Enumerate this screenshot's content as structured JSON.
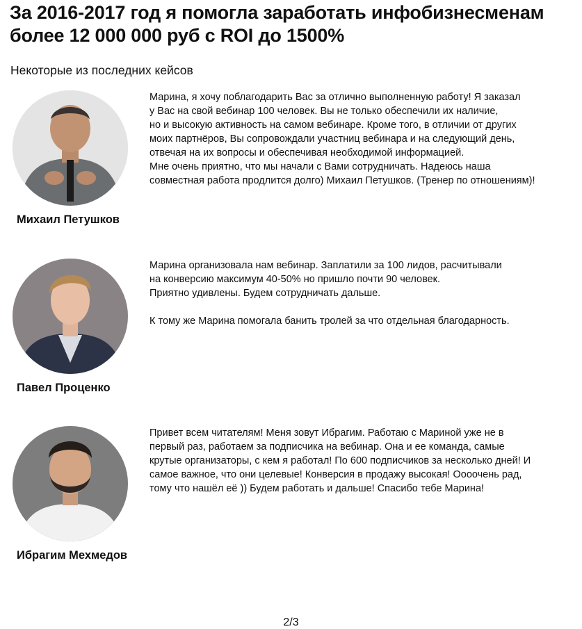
{
  "header": {
    "title_line1": "За 2016-2017 год я помогла заработать инфобизнесменам",
    "title_line2": "более 12 000 000 руб с ROI до 1500%",
    "subtitle": "Некоторые из последних кейсов"
  },
  "cases": [
    {
      "name": "Михаил Петушков",
      "lines": [
        "Марина, я хочу поблагодарить Вас за отлично выполненную работу! Я заказал",
        "у Вас на свой вебинар 100 человек. Вы не только обеспечили их наличие,",
        "но и высокую активность на самом вебинаре. Кроме того, в отличии от других",
        "моих партнёров, Вы сопровождали участниц вебинара и на следующий день,",
        "отвечая на их вопросы и обеспечивая необходимой информацией.",
        "Мне очень приятно, что мы начали с Вами сотрудничать. Надеюсь наша",
        "совместная работа продлится долго) Михаил Петушков. (Тренер по отношениям)!"
      ]
    },
    {
      "name": "Павел Проценко",
      "lines": [
        "Марина организовала нам вебинар. Заплатили за 100 лидов, расчитывали",
        "на конверсию максимум 40-50% но пришло почти 90 человек.",
        "Приятно удивлены. Будем сотрудничать дальше.",
        "",
        "К тому же Марина помогала банить тролей за что отдельная благодарность."
      ]
    },
    {
      "name": "Ибрагим Мехмедов",
      "lines": [
        "Привет всем читателям! Меня зовут Ибрагим. Работаю с Мариной уже не в",
        "первый раз, работаем за подписчика на вебинар. Она и ее команда, самые",
        "крутые организаторы, с кем я работал! По 600 подписчиков за несколько дней! И",
        "самое важное, что они целевые! Конверсия в продажу высокая! Оооочень рад,",
        "тому что нашёл её )) Будем работать и дальше! Спасибо тебе Марина!"
      ]
    }
  ],
  "footer": {
    "page_indicator": "2/3"
  }
}
